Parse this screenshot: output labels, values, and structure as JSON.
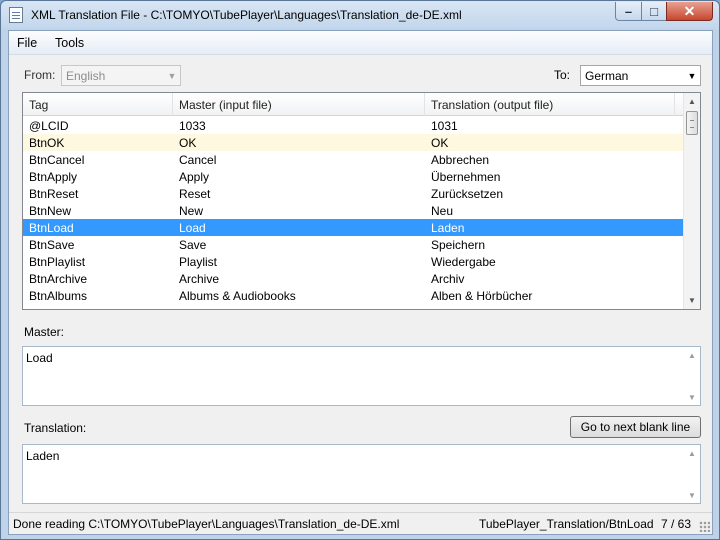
{
  "window": {
    "title": "XML Translation File - C:\\TOMYO\\TubePlayer\\Languages\\Translation_de-DE.xml",
    "minimize_glyph": "–",
    "maximize_glyph": "□",
    "close_glyph": "✕"
  },
  "menu": {
    "file": "File",
    "tools": "Tools"
  },
  "from": {
    "label": "From:",
    "value": "English",
    "enabled": false
  },
  "to": {
    "label": "To:",
    "value": "German"
  },
  "grid": {
    "columns": [
      "Tag",
      "Master (input file)",
      "Translation (output file)"
    ],
    "selected_index": 6,
    "rows": [
      {
        "tag": "@LCID",
        "master": "1033",
        "translation": "1031"
      },
      {
        "tag": "BtnOK",
        "master": "OK",
        "translation": "OK"
      },
      {
        "tag": "BtnCancel",
        "master": "Cancel",
        "translation": "Abbrechen"
      },
      {
        "tag": "BtnApply",
        "master": "Apply",
        "translation": "Übernehmen"
      },
      {
        "tag": "BtnReset",
        "master": "Reset",
        "translation": "Zurücksetzen"
      },
      {
        "tag": "BtnNew",
        "master": "New",
        "translation": "Neu"
      },
      {
        "tag": "BtnLoad",
        "master": "Load",
        "translation": "Laden"
      },
      {
        "tag": "BtnSave",
        "master": "Save",
        "translation": "Speichern"
      },
      {
        "tag": "BtnPlaylist",
        "master": "Playlist",
        "translation": "Wiedergabe"
      },
      {
        "tag": "BtnArchive",
        "master": "Archive",
        "translation": "Archiv"
      },
      {
        "tag": "BtnAlbums",
        "master": "Albums & Audiobooks",
        "translation": "Alben & Hörbücher"
      }
    ]
  },
  "master": {
    "label": "Master:",
    "text": "Load"
  },
  "translation": {
    "label": "Translation:",
    "text": "Laden",
    "next_blank_button": "Go to next blank line"
  },
  "status": {
    "left": "Done reading C:\\TOMYO\\TubePlayer\\Languages\\Translation_de-DE.xml",
    "path": "TubePlayer_Translation/BtnLoad",
    "position": "7 / 63"
  },
  "colors": {
    "selection": "#3399ff",
    "alt_row": "#fdf8df"
  },
  "icons": [
    "document-icon",
    "minimize-icon",
    "maximize-icon",
    "close-icon",
    "chevron-down-icon",
    "scroll-up-icon",
    "scroll-down-icon",
    "resize-grip-icon"
  ]
}
